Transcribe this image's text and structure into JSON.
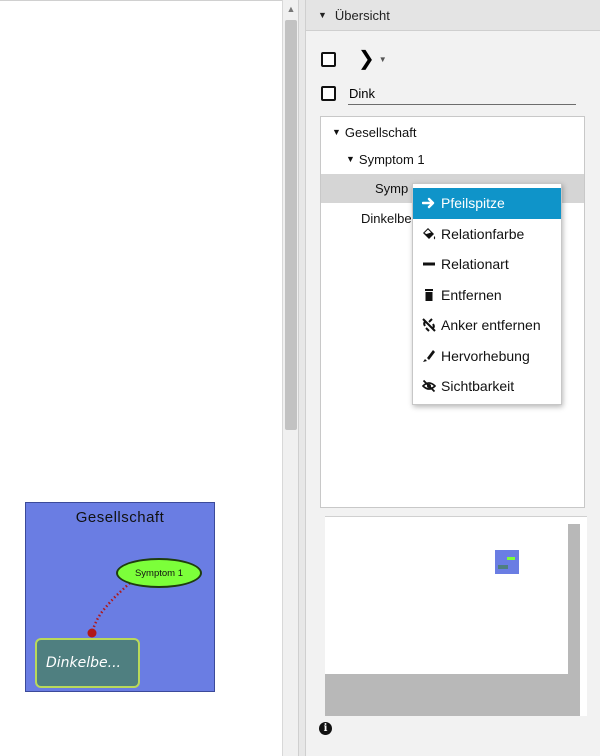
{
  "canvas": {
    "root_node": "Gesellschaft",
    "symptom_node": "Symptom 1",
    "dink_node": "Dinkelbe..."
  },
  "sidebar": {
    "overview_title": "Übersicht",
    "filter_value": "Dink",
    "tree": {
      "root": "Gesellschaft",
      "symptom": "Symptom 1",
      "selected_partial": "Symp",
      "dinkel_partial": "Dinkelbe"
    }
  },
  "context_menu": {
    "items": [
      {
        "label": "Pfeilspitze",
        "icon": "arrow-right-icon"
      },
      {
        "label": "Relationfarbe",
        "icon": "paint-bucket-icon"
      },
      {
        "label": "Relationart",
        "icon": "minus-icon"
      },
      {
        "label": "Entfernen",
        "icon": "trash-icon"
      },
      {
        "label": "Anker entfernen",
        "icon": "unlink-icon"
      },
      {
        "label": "Hervorhebung",
        "icon": "highlighter-icon"
      },
      {
        "label": "Sichtbarkeit",
        "icon": "eye-slash-icon"
      }
    ]
  },
  "colors": {
    "accent": "#0f94c9",
    "root_bg": "#6a7de3",
    "symptom_bg": "#7cff3a",
    "dink_bg": "#4f7f80",
    "link": "#b01818"
  }
}
